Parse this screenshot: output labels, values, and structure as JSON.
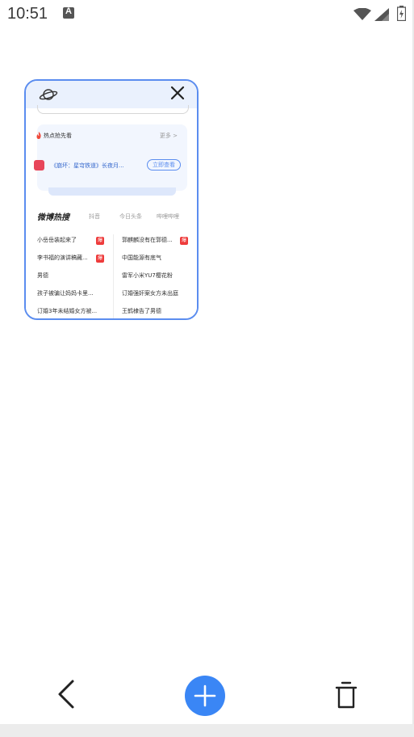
{
  "status_bar": {
    "time": "10:51",
    "notification_icon": "a-badge-icon",
    "wifi_icon": "wifi-icon",
    "signal_icon": "signal-icon",
    "battery_icon": "battery-charging-icon"
  },
  "tab_card": {
    "header_icon": "planet-icon",
    "close_icon": "close-icon",
    "hot_section": {
      "title": "热点抢先看",
      "more": "更多 >",
      "promo_text": "《崩坏：星穹铁道》长夜月...",
      "promo_button": "立即查看"
    },
    "tabs": [
      "微博热搜",
      "抖音",
      "今日头条",
      "哔哩哔哩"
    ],
    "left_items": [
      {
        "text": "小岳岳装起来了",
        "badge": "爆"
      },
      {
        "text": "李书福的演讲稿藏...",
        "badge": "爆"
      },
      {
        "text": "男德",
        "badge": ""
      },
      {
        "text": "孩子被骗让妈妈卡里...",
        "badge": ""
      },
      {
        "text": "订婚3年未结婚女方被...",
        "badge": ""
      }
    ],
    "right_items": [
      {
        "text": "郭麒麟没有在郭德...",
        "badge": "爆"
      },
      {
        "text": "中国能源有底气",
        "badge": ""
      },
      {
        "text": "雷军小米YU7樱花粉",
        "badge": ""
      },
      {
        "text": "订婚强奸案女方未出庭",
        "badge": ""
      },
      {
        "text": "王鹤棣告了男德",
        "badge": ""
      }
    ]
  },
  "bottom_nav": {
    "back_icon": "chevron-left-icon",
    "add_icon": "plus-icon",
    "trash_icon": "trash-icon"
  },
  "colors": {
    "accent": "#3a86f5",
    "card_border": "#5b8def",
    "hot_badge": "#ee3b3b"
  }
}
